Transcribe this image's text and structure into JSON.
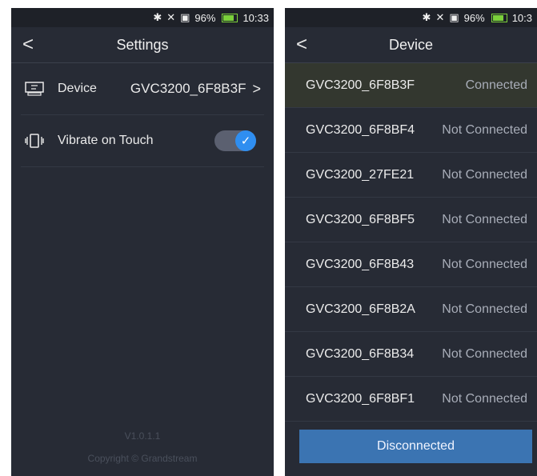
{
  "left": {
    "status": {
      "battery": "96%",
      "time": "10:33"
    },
    "title": "Settings",
    "rows": [
      {
        "label": "Device",
        "value": "GVC3200_6F8B3F"
      },
      {
        "label": "Vibrate on Touch",
        "toggle_on": true
      }
    ],
    "footer": {
      "version": "V1.0.1.1",
      "copyright": "Copyright © Grandstream"
    }
  },
  "right": {
    "status": {
      "battery": "96%",
      "time": "10:3"
    },
    "title": "Device",
    "devices": [
      {
        "name": "GVC3200_6F8B3F",
        "state": "Connected"
      },
      {
        "name": "GVC3200_6F8BF4",
        "state": "Not Connected"
      },
      {
        "name": "GVC3200_27FE21",
        "state": "Not Connected"
      },
      {
        "name": "GVC3200_6F8BF5",
        "state": "Not Connected"
      },
      {
        "name": "GVC3200_6F8B43",
        "state": "Not Connected"
      },
      {
        "name": "GVC3200_6F8B2A",
        "state": "Not Connected"
      },
      {
        "name": "GVC3200_6F8B34",
        "state": "Not Connected"
      },
      {
        "name": "GVC3200_6F8BF1",
        "state": "Not Connected"
      }
    ],
    "button_label": "Disconnected"
  },
  "colors": {
    "accent": "#2f8ef0",
    "button": "#3b74b2",
    "background": "#272b35"
  }
}
